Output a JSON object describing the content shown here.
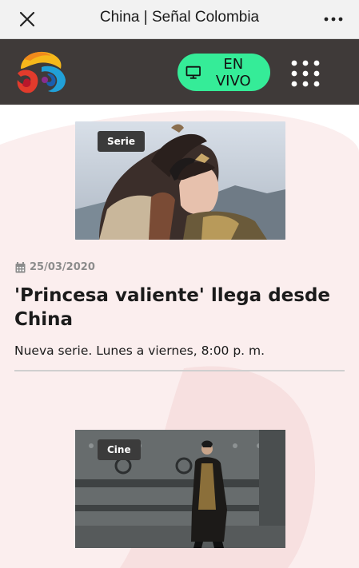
{
  "browser": {
    "title": "China | Señal Colombia",
    "close_icon": "close-icon",
    "more_icon": "more-options-icon"
  },
  "header": {
    "logo_icon": "senal-colombia-logo",
    "live_label": "EN VIVO",
    "live_icon": "tv-monitor-icon",
    "menu_icon": "app-grid-icon",
    "background_color": "#3f3a39",
    "live_color": "#35ec98"
  },
  "articles": [
    {
      "tag": "Serie",
      "date": "25/03/2020",
      "title": "'Princesa valiente' llega desde China",
      "subtitle": "Nueva serie. Lunes a viernes, 8:00 p. m."
    },
    {
      "tag": "Cine"
    }
  ]
}
